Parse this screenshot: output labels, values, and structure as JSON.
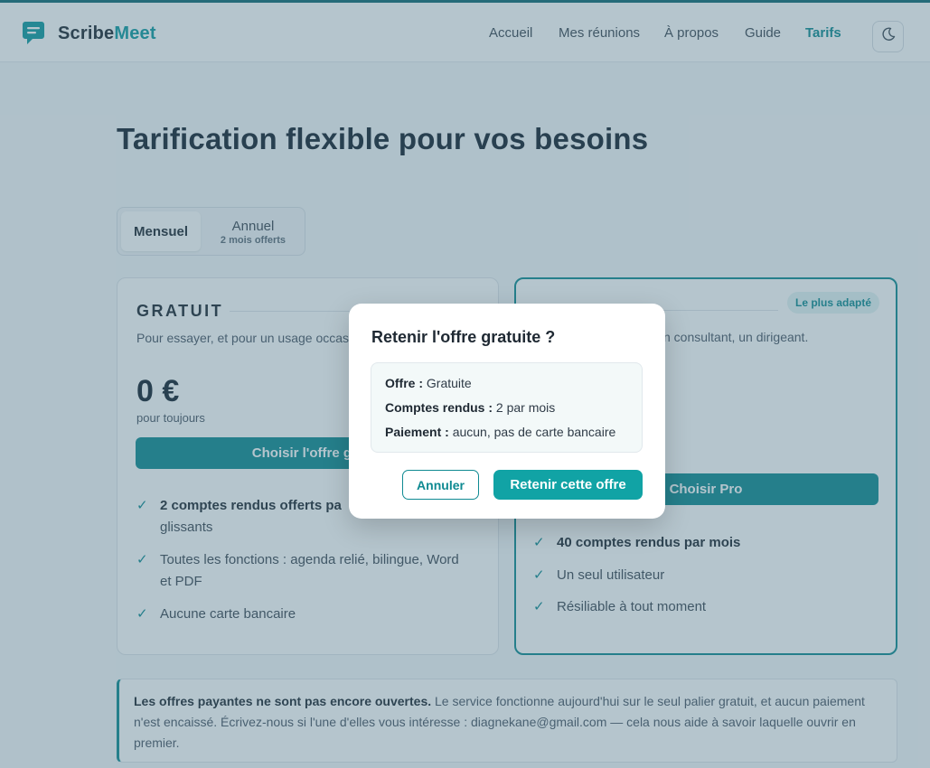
{
  "app": {
    "brand_part1": "Scribe",
    "brand_part2": "Meet",
    "logo_icon": "chat-bubble-icon",
    "accent_color": "#0f8a92"
  },
  "nav": {
    "items": [
      {
        "label": "Accueil"
      },
      {
        "label": "Mes réunions"
      },
      {
        "label": "À propos"
      },
      {
        "label": "Guide"
      },
      {
        "label": "Tarifs",
        "active": true
      }
    ],
    "theme_icon": "moon-icon"
  },
  "page": {
    "title": "Tarification flexible pour vos besoins"
  },
  "billing_toggle": {
    "monthly_label": "Mensuel",
    "annual_label": "Annuel",
    "annual_sub": "2 mois offerts",
    "selected": "Mensuel"
  },
  "plans": {
    "free": {
      "name": "GRATUIT",
      "description": "Pour essayer, et pour un usage occas",
      "price": "0 €",
      "price_sub": "pour toujours",
      "cta": "Choisir l'offre gra",
      "features": [
        {
          "bold": "2 comptes rendus offerts pa",
          "rest": ""
        },
        {
          "bold": "",
          "rest": "glissants"
        },
        {
          "bold": "",
          "rest": "Toutes les fonctions : agenda relié, bilingue, Word"
        },
        {
          "bold": "",
          "rest": "et PDF"
        },
        {
          "bold": "",
          "rest": "Aucune carte bancaire"
        }
      ]
    },
    "pro": {
      "badge": "Le plus adapté",
      "description": "n consultant, un dirigeant.",
      "cta": "Choisir Pro",
      "features": [
        {
          "bold": "40 comptes rendus par mois",
          "rest": ""
        },
        {
          "bold": "",
          "rest": "Un seul utilisateur"
        },
        {
          "bold": "",
          "rest": "Résiliable à tout moment"
        }
      ]
    }
  },
  "notice": {
    "bold": "Les offres payantes ne sont pas encore ouvertes.",
    "text": " Le service fonctionne aujourd'hui sur le seul palier gratuit, et aucun paiement n'est encaissé. Écrivez-nous si l'une d'elles vous intéresse : diagnekane@gmail.com — cela nous aide à savoir laquelle ouvrir en premier."
  },
  "modal": {
    "title": "Retenir l'offre gratuite ?",
    "rows": [
      {
        "label": "Offre :",
        "value": " Gratuite"
      },
      {
        "label": "Comptes rendus :",
        "value": " 2 par mois"
      },
      {
        "label": "Paiement :",
        "value": " aucun, pas de carte bancaire"
      }
    ],
    "cancel_label": "Annuler",
    "confirm_label": "Retenir cette offre"
  }
}
